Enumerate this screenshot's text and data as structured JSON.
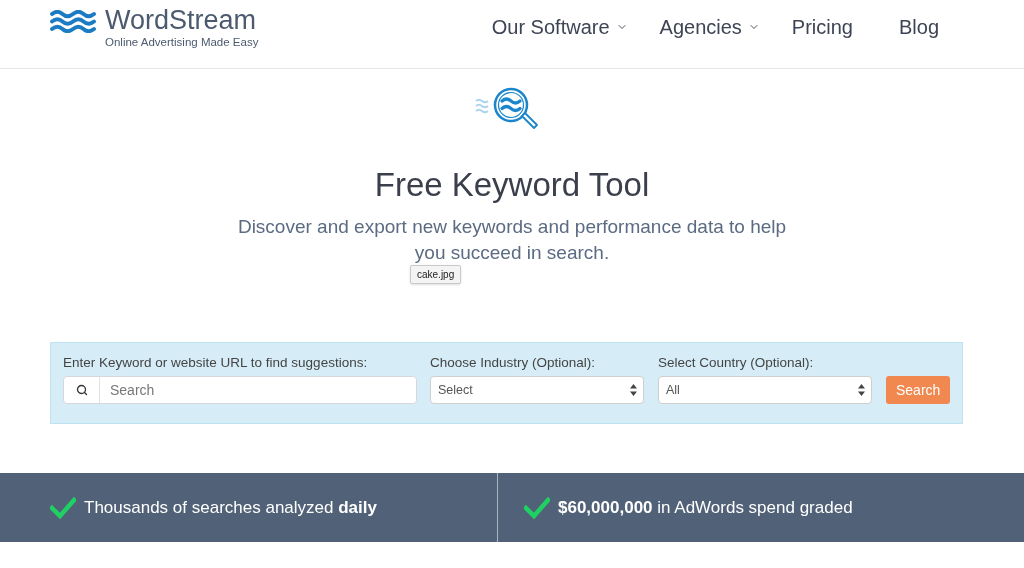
{
  "header": {
    "logo": {
      "name": "WordStream",
      "tagline": "Online Advertising Made Easy"
    },
    "nav": [
      {
        "label": "Our Software",
        "has_menu": true
      },
      {
        "label": "Agencies",
        "has_menu": true
      },
      {
        "label": "Pricing",
        "has_menu": false
      },
      {
        "label": "Blog",
        "has_menu": false
      }
    ]
  },
  "hero": {
    "title": "Free Keyword Tool",
    "subtitle": "Discover and export new keywords and performance data to help you succeed in search.",
    "tooltip": "cake.jpg"
  },
  "search_form": {
    "keyword": {
      "label": "Enter Keyword or website URL to find suggestions:",
      "placeholder": "Search"
    },
    "industry": {
      "label": "Choose Industry (Optional):",
      "value": "Select"
    },
    "country": {
      "label": "Select Country (Optional):",
      "value": "All"
    },
    "button": "Search"
  },
  "stats": [
    "Thousands of searches analyzed **daily**",
    "**$60,000,000** in AdWords spend graded"
  ]
}
